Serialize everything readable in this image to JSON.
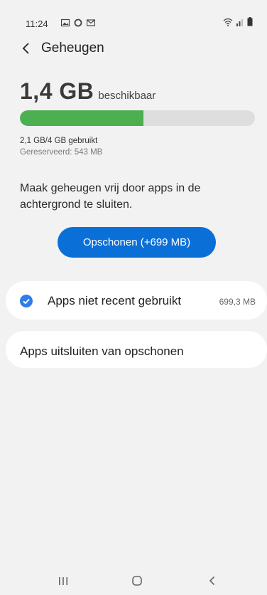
{
  "status_bar": {
    "time": "11:24",
    "left_icons": [
      "image-icon",
      "circle-icon",
      "mail-icon"
    ],
    "right_icons": [
      "wifi-icon",
      "signal-icon",
      "battery-icon"
    ]
  },
  "header": {
    "title": "Geheugen"
  },
  "storage": {
    "available_value": "1,4 GB",
    "available_label": "beschikbaar",
    "used_fraction": 0.525,
    "used_text": "2,1 GB/4 GB gebruikt",
    "reserved_text": "Gereserveerd: 543 MB"
  },
  "description": "Maak geheugen vrij door apps in de achtergrond te sluiten.",
  "clean_button": {
    "label": "Opschonen (+699 MB)"
  },
  "options": {
    "apps_not_recent": {
      "label": "Apps niet recent gebruikt",
      "value": "699,3 MB",
      "checked": true
    },
    "exclude_apps": {
      "label": "Apps uitsluiten van opschonen"
    }
  },
  "colors": {
    "accent": "#0b6fd8",
    "progress": "#4caf50",
    "check": "#2f7ee8"
  },
  "nav_bar": {
    "icons": [
      "recent-apps-icon",
      "home-icon",
      "back-nav-icon"
    ]
  }
}
